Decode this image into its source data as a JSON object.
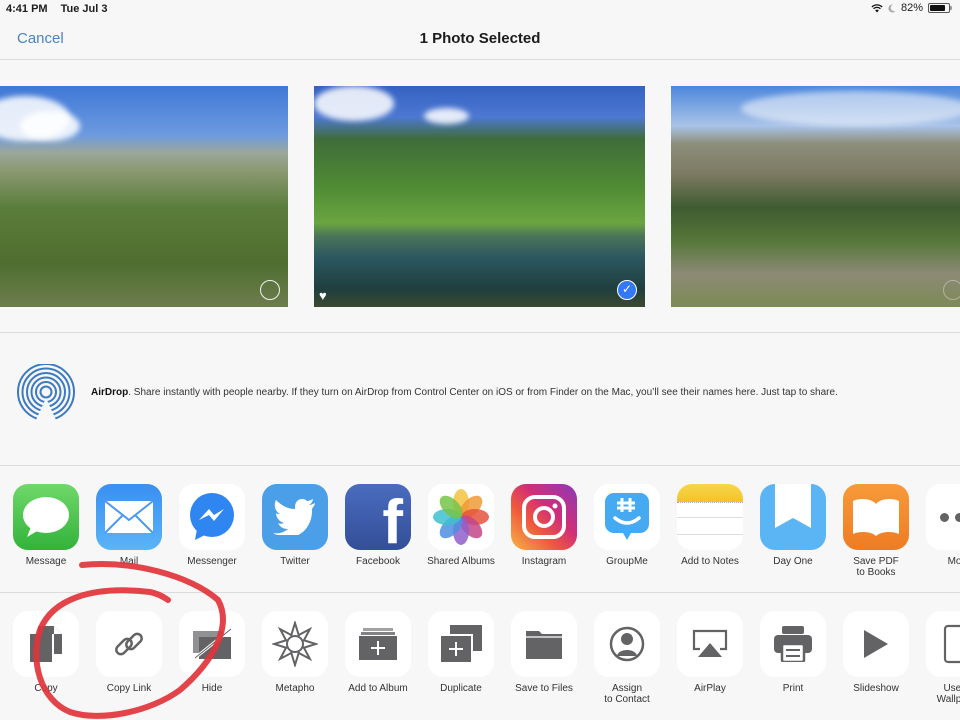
{
  "status_bar": {
    "time": "4:41 PM",
    "date": "Tue Jul 3",
    "battery": "82%",
    "battery_level": 0.82
  },
  "nav": {
    "cancel_label": "Cancel",
    "title": "1 Photo Selected"
  },
  "photos": [
    {
      "name": "alpine-meadow",
      "selected": false,
      "favorite": false
    },
    {
      "name": "mountain-lake",
      "selected": true,
      "favorite": true
    },
    {
      "name": "forest-valley",
      "selected": false,
      "favorite": false
    }
  ],
  "airdrop": {
    "title": "AirDrop",
    "description": ". Share instantly with people nearby. If they turn on AirDrop from Control Center on iOS or from Finder on the Mac, you’ll see their names here. Just tap to share."
  },
  "share_apps": [
    {
      "label": "Message",
      "icon": "message-icon"
    },
    {
      "label": "Mail",
      "icon": "mail-icon"
    },
    {
      "label": "Messenger",
      "icon": "messenger-icon"
    },
    {
      "label": "Twitter",
      "icon": "twitter-icon"
    },
    {
      "label": "Facebook",
      "icon": "facebook-icon"
    },
    {
      "label": "Shared Albums",
      "icon": "photos-icon"
    },
    {
      "label": "Instagram",
      "icon": "instagram-icon"
    },
    {
      "label": "GroupMe",
      "icon": "groupme-icon"
    },
    {
      "label": "Add to Notes",
      "icon": "notes-icon"
    },
    {
      "label": "Day One",
      "icon": "day-one-icon"
    },
    {
      "label": "Save PDF\nto Books",
      "icon": "books-icon"
    },
    {
      "label": "More",
      "icon": "more-icon"
    }
  ],
  "actions": [
    {
      "label": "Copy",
      "icon": "copy-icon"
    },
    {
      "label": "Copy Link",
      "icon": "link-icon"
    },
    {
      "label": "Hide",
      "icon": "hide-icon"
    },
    {
      "label": "Metapho",
      "icon": "metapho-icon"
    },
    {
      "label": "Add to Album",
      "icon": "add-album-icon"
    },
    {
      "label": "Duplicate",
      "icon": "duplicate-icon"
    },
    {
      "label": "Save to Files",
      "icon": "folder-icon"
    },
    {
      "label": "Assign\nto Contact",
      "icon": "contact-icon"
    },
    {
      "label": "AirPlay",
      "icon": "airplay-icon"
    },
    {
      "label": "Print",
      "icon": "printer-icon"
    },
    {
      "label": "Slideshow",
      "icon": "play-icon"
    },
    {
      "label": "Use as\nWallpaper",
      "icon": "wallpaper-icon"
    }
  ],
  "colors": {
    "accent": "#4a84c2",
    "annotation": "#e0343a",
    "action_glyph": "#636366"
  }
}
